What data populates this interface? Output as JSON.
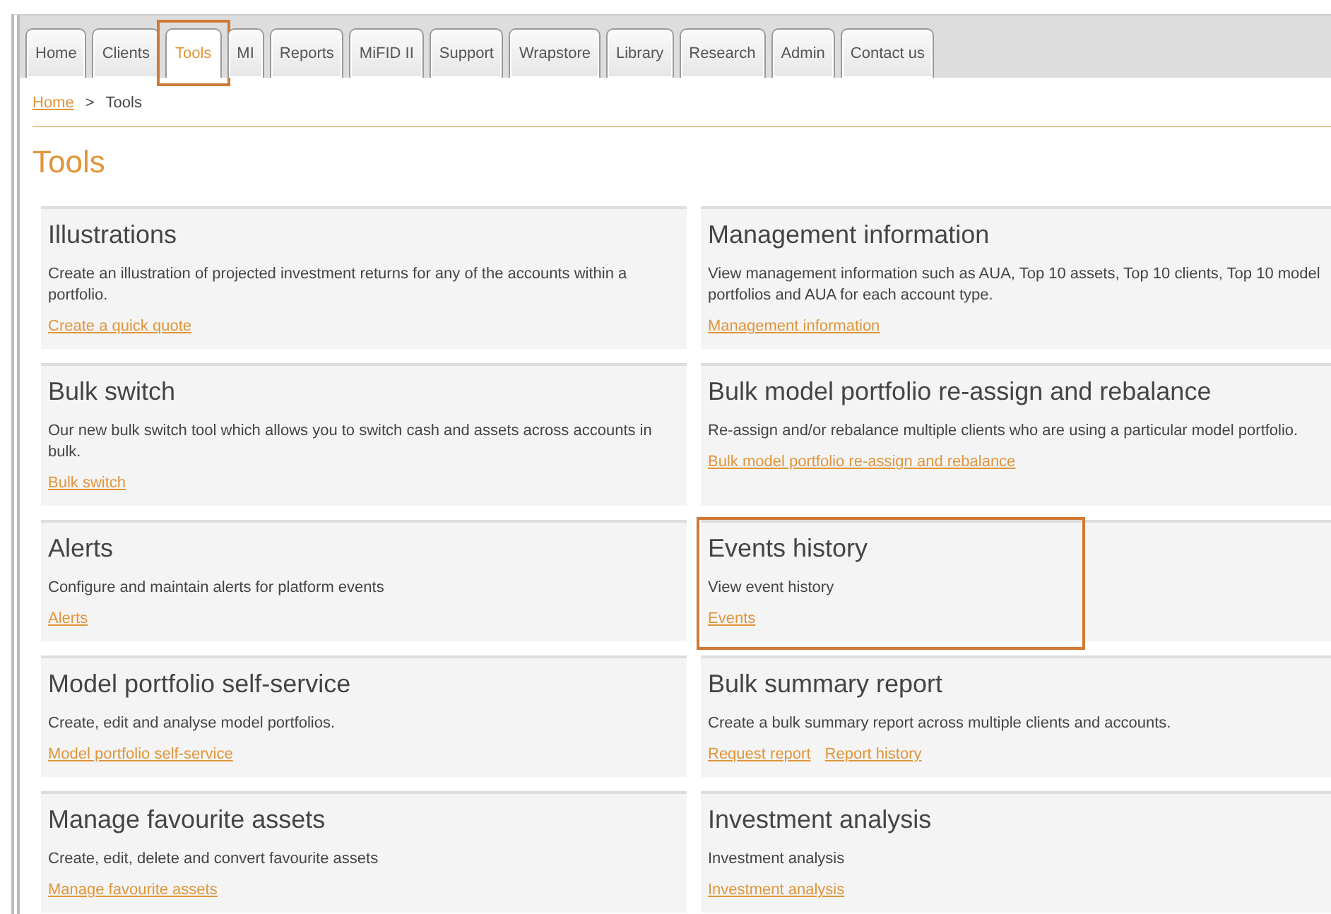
{
  "tabs": [
    {
      "label": "Home",
      "selected": false,
      "highlighted": false
    },
    {
      "label": "Clients",
      "selected": false,
      "highlighted": false
    },
    {
      "label": "Tools",
      "selected": true,
      "highlighted": true
    },
    {
      "label": "MI",
      "selected": false,
      "highlighted": false
    },
    {
      "label": "Reports",
      "selected": false,
      "highlighted": false
    },
    {
      "label": "MiFID II",
      "selected": false,
      "highlighted": false
    },
    {
      "label": "Support",
      "selected": false,
      "highlighted": false
    },
    {
      "label": "Wrapstore",
      "selected": false,
      "highlighted": false
    },
    {
      "label": "Library",
      "selected": false,
      "highlighted": false
    },
    {
      "label": "Research",
      "selected": false,
      "highlighted": false
    },
    {
      "label": "Admin",
      "selected": false,
      "highlighted": false
    },
    {
      "label": "Contact us",
      "selected": false,
      "highlighted": false
    }
  ],
  "breadcrumb": {
    "items": [
      {
        "label": "Home",
        "kind": "link"
      },
      {
        "label": "Tools",
        "kind": "current"
      }
    ],
    "separator": ">"
  },
  "title": "Tools",
  "cards": [
    {
      "title": "Illustrations",
      "description": "Create an illustration of projected investment returns for any of the accounts within a portfolio.",
      "links": [
        "Create a quick quote"
      ],
      "highlighted": false
    },
    {
      "title": "Management information",
      "description": "View management information such as AUA, Top 10 assets, Top 10 clients, Top 10 model portfolios and AUA for each account type.",
      "links": [
        "Management information"
      ],
      "highlighted": false
    },
    {
      "title": "Bulk switch",
      "description": "Our new bulk switch tool which allows you to switch cash and assets across accounts in bulk.",
      "links": [
        "Bulk switch"
      ],
      "highlighted": false
    },
    {
      "title": "Bulk model portfolio re-assign and rebalance",
      "description": "Re-assign and/or rebalance multiple clients who are using a particular model portfolio.",
      "links": [
        "Bulk model portfolio re-assign and rebalance"
      ],
      "highlighted": false
    },
    {
      "title": "Alerts",
      "description": "Configure and maintain alerts for platform events",
      "links": [
        "Alerts"
      ],
      "highlighted": false
    },
    {
      "title": "Events history",
      "description": "View event history",
      "links": [
        "Events"
      ],
      "highlighted": true
    },
    {
      "title": "Model portfolio self-service",
      "description": "Create, edit and analyse model portfolios.",
      "links": [
        "Model portfolio self-service"
      ],
      "highlighted": false
    },
    {
      "title": "Bulk summary report",
      "description": "Create a bulk summary report across multiple clients and accounts.",
      "links": [
        "Request report",
        "Report history"
      ],
      "highlighted": false
    },
    {
      "title": "Manage favourite assets",
      "description": "Create, edit, delete and convert favourite assets",
      "links": [
        "Manage favourite assets"
      ],
      "highlighted": false
    },
    {
      "title": "Investment analysis",
      "description": "Investment analysis",
      "links": [
        "Investment analysis"
      ],
      "highlighted": false
    }
  ]
}
